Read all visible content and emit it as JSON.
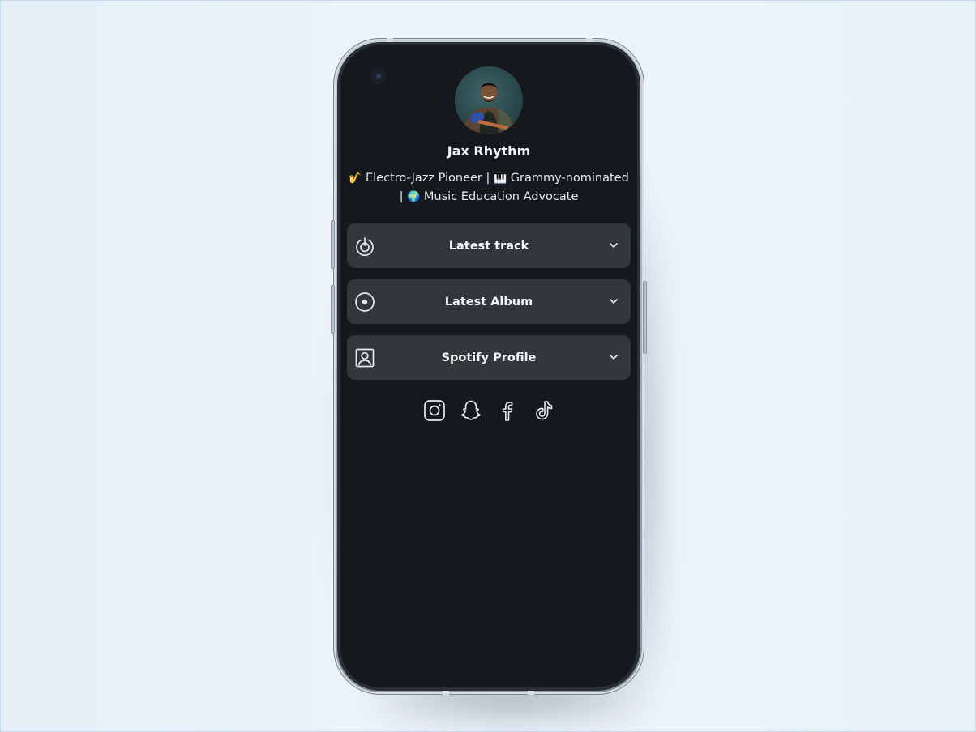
{
  "profile": {
    "name": "Jax Rhythm",
    "avatar_alt": "Profile photo of Jax Rhythm holding a blue guitar",
    "bio": {
      "line1": [
        {
          "type": "emoji",
          "icon": "saxophone-icon",
          "glyph": "🎷"
        },
        {
          "type": "text",
          "value": " Electro-Jazz Pioneer | "
        },
        {
          "type": "emoji",
          "icon": "piano-keys-icon",
          "glyph": "🎹"
        },
        {
          "type": "text",
          "value": " Grammy-nominated"
        }
      ],
      "line2": [
        {
          "type": "text",
          "value": "| "
        },
        {
          "type": "emoji",
          "icon": "globe-icon",
          "glyph": "🌍"
        },
        {
          "type": "text",
          "value": " Music Education Advocate"
        }
      ]
    }
  },
  "links": [
    {
      "label": "Latest track",
      "icon": "power-disc-icon",
      "expanded": false
    },
    {
      "label": "Latest Album",
      "icon": "record-disc-icon",
      "expanded": false
    },
    {
      "label": "Spotify Profile",
      "icon": "profile-portrait-icon",
      "expanded": false
    }
  ],
  "socials": [
    {
      "name": "instagram",
      "icon": "instagram-icon"
    },
    {
      "name": "snapchat",
      "icon": "snapchat-icon"
    },
    {
      "name": "facebook",
      "icon": "facebook-icon"
    },
    {
      "name": "tiktok",
      "icon": "tiktok-icon"
    }
  ],
  "colors": {
    "screen_bg": "#15191d",
    "card_bg": "#33373c",
    "text_primary": "#f2f4f6"
  }
}
